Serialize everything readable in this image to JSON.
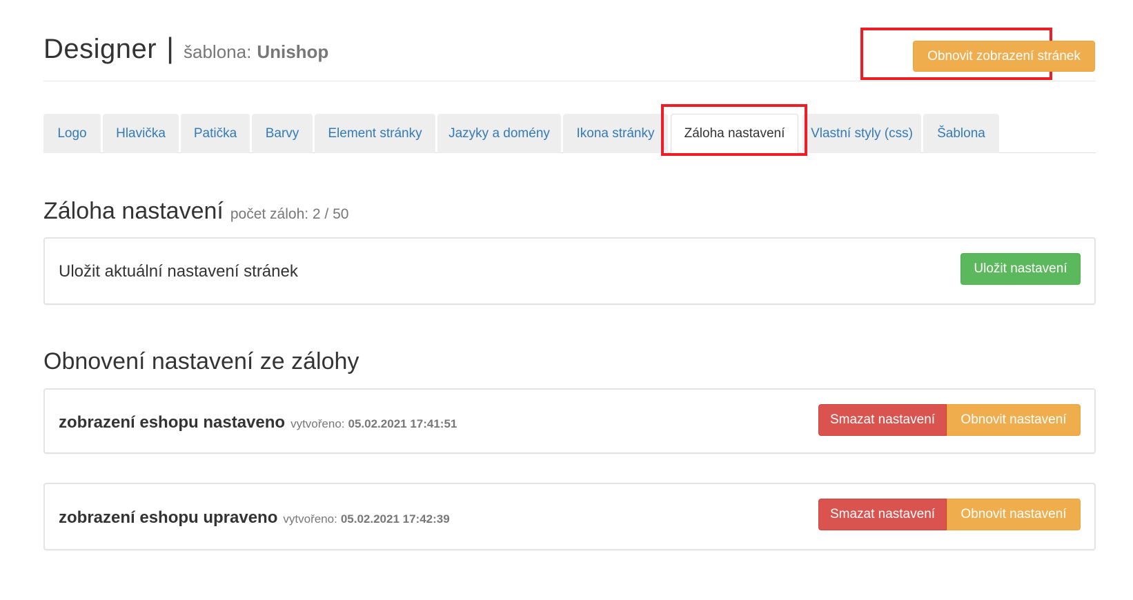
{
  "header": {
    "app_name": "Designer",
    "separator": "|",
    "template_label": "šablona:",
    "template_name": "Unishop",
    "refresh_button": "Obnovit zobrazení stránek"
  },
  "tabs": [
    {
      "label": "Logo",
      "active": false
    },
    {
      "label": "Hlavička",
      "active": false
    },
    {
      "label": "Patička",
      "active": false
    },
    {
      "label": "Barvy",
      "active": false
    },
    {
      "label": "Element stránky",
      "active": false
    },
    {
      "label": "Jazyky a domény",
      "active": false
    },
    {
      "label": "Ikona stránky",
      "active": false
    },
    {
      "label": "Záloha nastavení",
      "active": true
    },
    {
      "label": "Vlastní styly (css)",
      "active": false
    },
    {
      "label": "Šablona",
      "active": false
    }
  ],
  "backup_section": {
    "title": "Záloha nastavení",
    "count_text": "počet záloh: 2 / 50",
    "save_panel_text": "Uložit aktuální nastavení stránek",
    "save_button": "Uložit nastavení"
  },
  "restore_section": {
    "title": "Obnovení nastavení ze zálohy",
    "items": [
      {
        "name": "zobrazení eshopu nastaveno",
        "created_label": "vytvořeno:",
        "created_at": "05.02.2021 17:41:51",
        "delete_button": "Smazat nastavení",
        "restore_button": "Obnovit nastavení"
      },
      {
        "name": "zobrazení eshopu upraveno",
        "created_label": "vytvořeno:",
        "created_at": "05.02.2021 17:42:39",
        "delete_button": "Smazat nastavení",
        "restore_button": "Obnovit nastavení"
      }
    ]
  },
  "colors": {
    "highlight": "#ee1c25",
    "warning": "#f0ad4e",
    "success": "#5cb85c",
    "danger": "#d9534f",
    "link": "#337ab7"
  }
}
